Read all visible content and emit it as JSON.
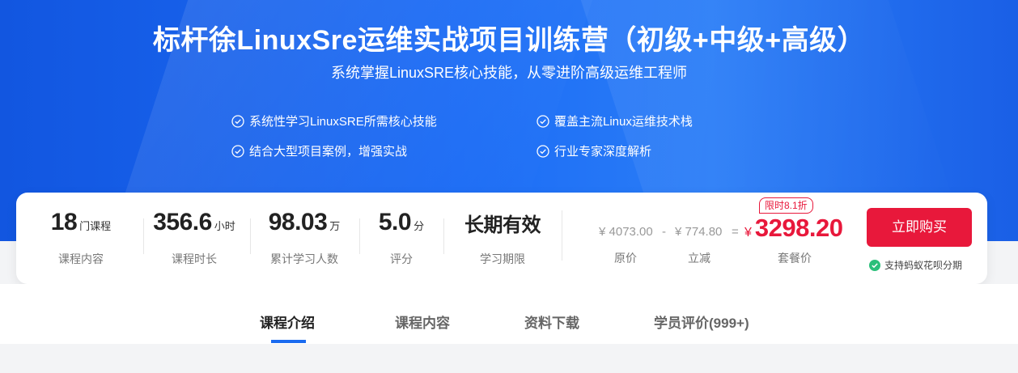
{
  "hero": {
    "title": "标杆徐LinuxSre运维实战项目训练营（初级+中级+高级）",
    "subtitle": "系统掌握LinuxSRE核心技能，从零进阶高级运维工程师",
    "features": [
      "系统性学习LinuxSRE所需核心技能",
      "覆盖主流Linux运维技术栈",
      "结合大型项目案例，增强实战",
      "行业专家深度解析"
    ],
    "colors": {
      "background": "#1c6cf5",
      "text": "#ffffff"
    }
  },
  "stats": [
    {
      "value": "18",
      "unit": "门课程",
      "label": "课程内容"
    },
    {
      "value": "356.6",
      "unit": "小时",
      "label": "课程时长"
    },
    {
      "value": "98.03",
      "unit": "万",
      "label": "累计学习人数"
    },
    {
      "value": "5.0",
      "unit": "分",
      "label": "评分"
    },
    {
      "value": "长期有效",
      "unit": "",
      "label": "学习期限"
    }
  ],
  "pricing": {
    "original": "¥ 4073.00",
    "minus": "-",
    "discount": "¥ 774.80",
    "equals": "=",
    "original_label": "原价",
    "discount_label": "立减",
    "tag": "限时8.1折",
    "currency": "¥",
    "final": "3298.20",
    "final_label": "套餐价",
    "buy_button": "立即购买",
    "installment": "支持蚂蚁花呗分期",
    "accent_color": "#e8183b"
  },
  "tabs": [
    {
      "label": "课程介绍",
      "active": true
    },
    {
      "label": "课程内容",
      "active": false
    },
    {
      "label": "资料下载",
      "active": false
    },
    {
      "label": "学员评价(999+)",
      "active": false
    }
  ]
}
